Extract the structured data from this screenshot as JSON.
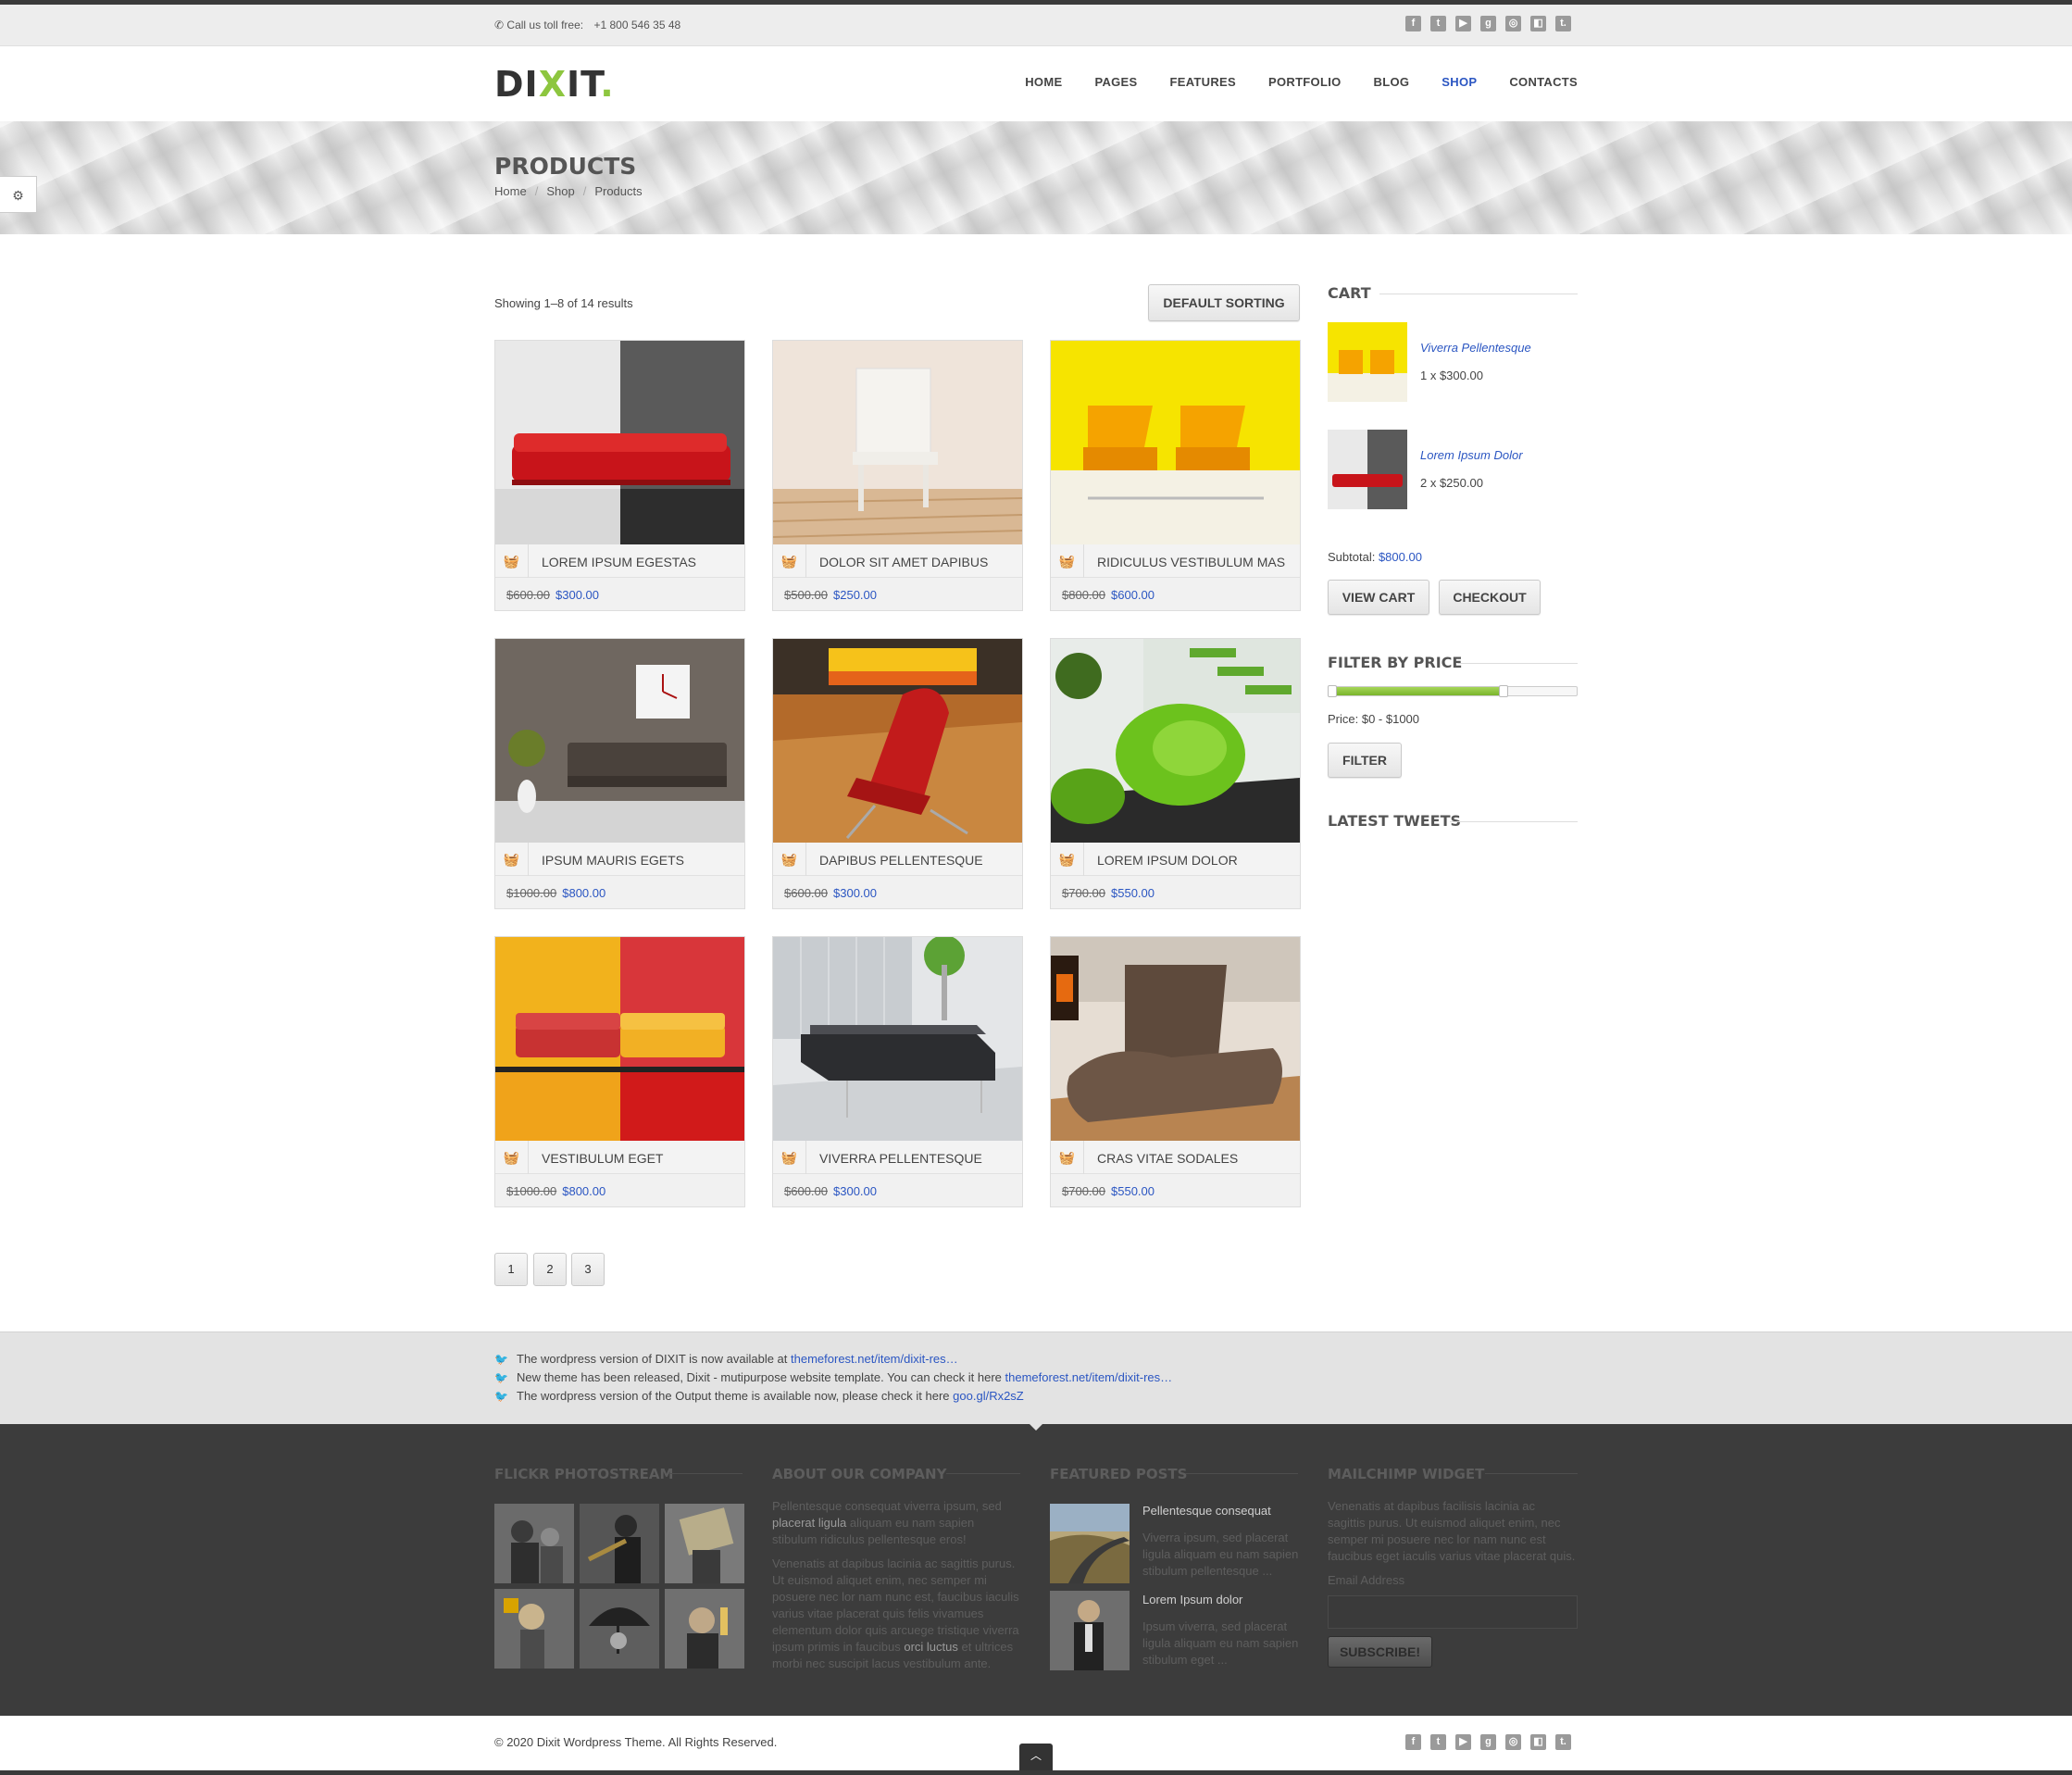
{
  "topbar": {
    "phone_label": "Call us toll free:",
    "phone_number": "+1 800 546 35 48"
  },
  "social_icons": [
    "facebook-icon",
    "twitter-icon",
    "youtube-icon",
    "googleplus-icon",
    "dribbble-icon",
    "delicious-icon",
    "tumblr-icon"
  ],
  "brand": {
    "logo_main": "DI",
    "logo_x": "X",
    "logo_end": "IT",
    "logo_dot": "."
  },
  "nav": {
    "home": "HOME",
    "pages": "PAGES",
    "features": "FEATURES",
    "portfolio": "PORTFOLIO",
    "blog": "BLOG",
    "shop": "SHOP",
    "contacts": "CONTACTS",
    "active": "SHOP"
  },
  "banner": {
    "title": "PRODUCTS",
    "crumb1": "Home",
    "crumb2": "Shop",
    "crumb3": "Products",
    "sep": "/"
  },
  "results": {
    "showing": "Showing 1–8 of 14 results",
    "sort_label": "DEFAULT SORTING"
  },
  "products": [
    {
      "name": "LOREM IPSUM EGESTAS",
      "old": "$600.00",
      "new": "$300.00"
    },
    {
      "name": "DOLOR SIT AMET DAPIBUS",
      "old": "$500.00",
      "new": "$250.00"
    },
    {
      "name": "RIDICULUS VESTIBULUM MAS",
      "old": "$800.00",
      "new": "$600.00"
    },
    {
      "name": "IPSUM MAURIS EGETS",
      "old": "$1000.00",
      "new": "$800.00"
    },
    {
      "name": "DAPIBUS PELLENTESQUE",
      "old": "$600.00",
      "new": "$300.00"
    },
    {
      "name": "LOREM IPSUM DOLOR",
      "old": "$700.00",
      "new": "$550.00"
    },
    {
      "name": "VESTIBULUM EGET",
      "old": "$1000.00",
      "new": "$800.00"
    },
    {
      "name": "VIVERRA PELLENTESQUE",
      "old": "$600.00",
      "new": "$300.00"
    },
    {
      "name": "CRAS VITAE SODALES",
      "old": "$700.00",
      "new": "$550.00"
    }
  ],
  "pagination": [
    "1",
    "2",
    "3"
  ],
  "cart": {
    "title": "CART",
    "items": [
      {
        "name": "Viverra Pellentesque",
        "qty": "1 x $300.00"
      },
      {
        "name": "Lorem Ipsum Dolor",
        "qty": "2 x $250.00"
      }
    ],
    "subtotal_label": "Subtotal:",
    "subtotal_value": "$800.00",
    "view_cart": "VIEW CART",
    "checkout": "CHECKOUT"
  },
  "filter": {
    "title": "FILTER BY PRICE",
    "price_label": "Price: $0 - $1000",
    "button": "FILTER",
    "range_min_fraction": 0.02,
    "range_max_fraction": 0.7
  },
  "latest_tweets": {
    "title": "LATEST TWEETS"
  },
  "tweets": [
    {
      "text": "The wordpress version of DIXIT is now available at ",
      "link": "themeforest.net/item/dixit-res…"
    },
    {
      "text": "New theme has been released, Dixit - mutipurpose website template. You can check it here ",
      "link": "themeforest.net/item/dixit-res…"
    },
    {
      "text": "The wordpress version of the Output theme is available now, please check it here ",
      "link": "goo.gl/Rx2sZ"
    }
  ],
  "footer": {
    "flickr_title": "FLICKR PHOTOSTREAM",
    "about_title": "ABOUT OUR COMPANY",
    "about_p1_a": "Pellentesque consequat viverra ipsum, sed",
    "about_p1_b": "placerat ligula",
    "about_p1_c": "aliquam eu nam sapien",
    "about_p1_d": "stibulum ridiculus pellentesque eros!",
    "about_p2_1": "Venenatis at dapibus lacinia ac sagittis purus.",
    "about_p2_2": "Ut euismod aliquet enim, nec semper mi",
    "about_p2_3": "posuere nec lor nam nunc est, faucibus iaculis",
    "about_p2_4": "varius vitae placerat quis felis vivamues",
    "about_p2_5": "elementum dolor quis arcuege tristique viverra",
    "about_p2_6a": "ipsum primis in faucibus",
    "about_p2_6b": "orci luctus",
    "about_p2_6c": "et ultrices",
    "about_p2_7": "morbi nec suscipit lacus vestibulum ante.",
    "featured_title": "FEATURED POSTS",
    "posts": [
      {
        "title": "Pellentesque consequat",
        "l1": "Viverra ipsum, sed placerat",
        "l2": "ligula aliquam eu nam sapien",
        "l3": "stibulum pellentesque ..."
      },
      {
        "title": "Lorem Ipsum dolor",
        "l1": "Ipsum viverra, sed placerat",
        "l2": "ligula aliquam eu nam sapien",
        "l3": "stibulum eget ..."
      }
    ],
    "mailchimp_title": "MAILCHIMP WIDGET",
    "mc_1": "Venenatis at dapibus facilisis lacinia ac",
    "mc_2": "sagittis purus. Ut euismod aliquet enim, nec",
    "mc_3": "semper mi posuere nec lor nam nunc est",
    "mc_4": "faucibus eget iaculis varius vitae placerat quis.",
    "email_label": "Email Address",
    "subscribe": "SUBSCRIBE!"
  },
  "bottom": {
    "copyright": "© 2020 Dixit Wordpress Theme. All Rights Reserved.",
    "totop_icon": "chevron-up-icon"
  }
}
